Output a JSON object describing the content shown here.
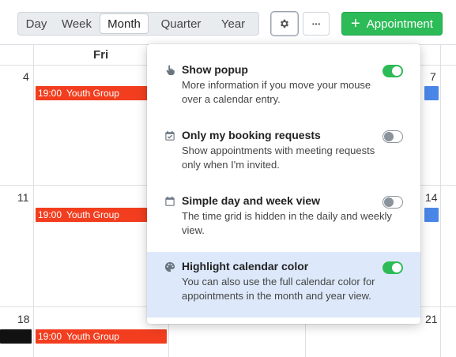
{
  "toolbar": {
    "views": [
      "Day",
      "Week",
      "Month",
      "Quarter",
      "Year"
    ],
    "active_view": "Month",
    "more_label": "···",
    "appointment_label": "Appointment",
    "appointment_plus": "+"
  },
  "calendar": {
    "column_header": "Fri",
    "day_numbers": {
      "row1_left": "4",
      "row1_right": "7",
      "row2_left": "11",
      "row2_right": "14",
      "row3_left": "18",
      "row3_right": "21"
    },
    "event": {
      "time": "19:00",
      "title": "Youth Group"
    }
  },
  "settings": {
    "options": [
      {
        "title": "Show popup",
        "desc": "More information if you move your mouse over a calendar entry.",
        "enabled": true
      },
      {
        "title": "Only my booking requests",
        "desc": "Show appointments with meeting requests only when I'm invited.",
        "enabled": false
      },
      {
        "title": "Simple day and week view",
        "desc": "The time grid is hidden in the daily and weekly view.",
        "enabled": false
      },
      {
        "title": "Highlight calendar color",
        "desc": "You can also use the full calendar color for appointments in the month and year view.",
        "enabled": true
      }
    ]
  },
  "colors": {
    "event_red": "#f23e1f",
    "accent_green": "#2dbb57",
    "event_blue": "#4a86e8",
    "highlight_bg": "#dde9fb"
  }
}
